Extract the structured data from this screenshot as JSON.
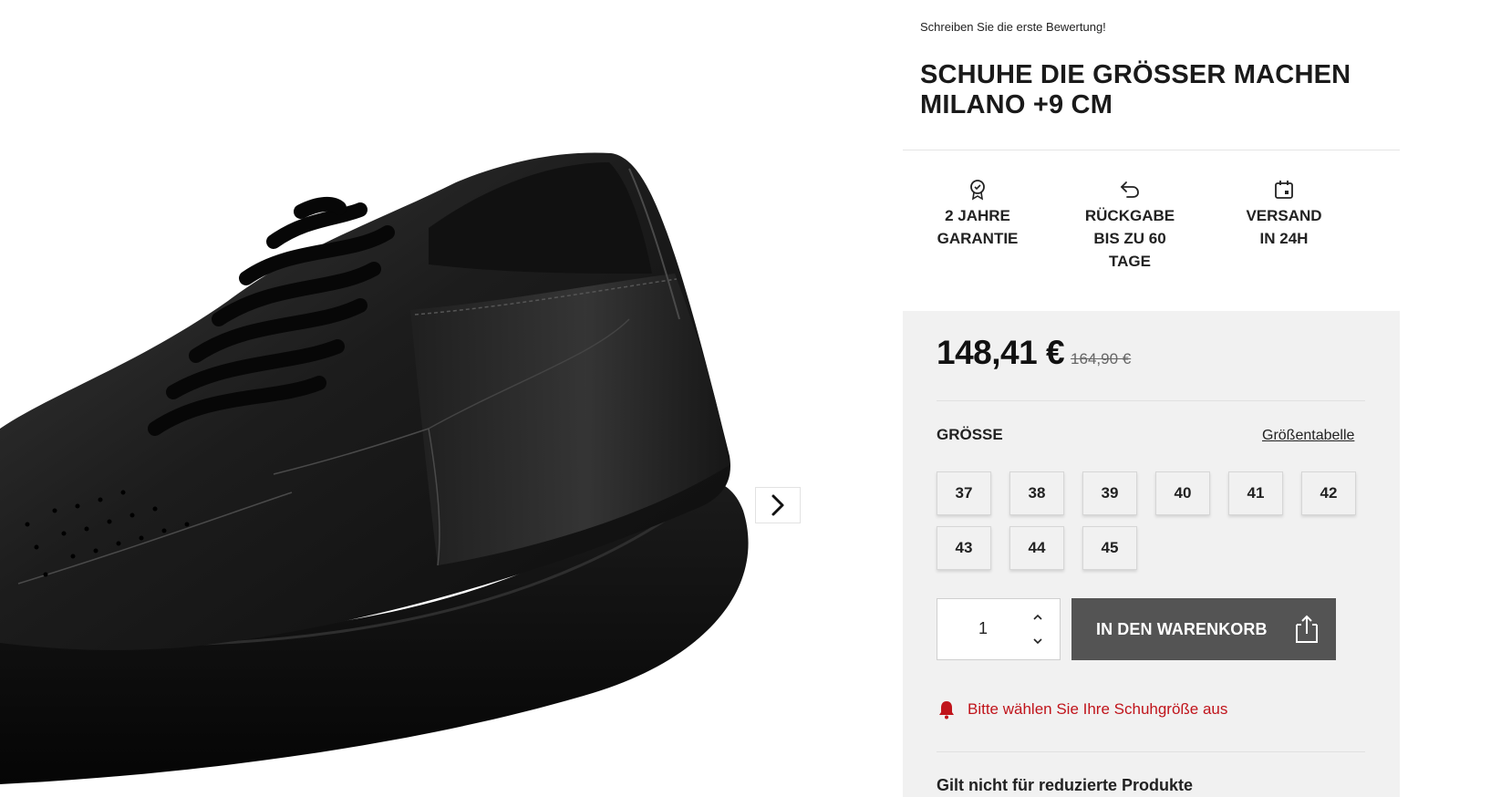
{
  "gallery": {
    "image_alt": "black leather sneaker",
    "next_icon": "chevron-right-icon"
  },
  "product": {
    "review_link": "Schreiben Sie die erste Bewertung!",
    "title": "SCHUHE DIE GRÖSSER MACHEN MILANO +9 CM"
  },
  "benefits": [
    {
      "icon": "warranty-badge-icon",
      "label_line1": "2 JAHRE",
      "label_line2": "GARANTIE",
      "label_line3": ""
    },
    {
      "icon": "return-arrow-icon",
      "label_line1": "RÜCKGABE",
      "label_line2": "BIS ZU 60",
      "label_line3": "TAGE"
    },
    {
      "icon": "calendar-icon",
      "label_line1": "VERSAND",
      "label_line2": "IN 24H",
      "label_line3": ""
    }
  ],
  "price": {
    "current": "148,41 €",
    "old": "164,90 €"
  },
  "size": {
    "label": "GRÖSSE",
    "chart_link": "Größentabelle",
    "options": [
      "37",
      "38",
      "39",
      "40",
      "41",
      "42",
      "43",
      "44",
      "45"
    ]
  },
  "quantity": {
    "value": "1"
  },
  "cart": {
    "button_label": "IN DEN WARENKORB",
    "icon": "shopping-bag-icon"
  },
  "warning": {
    "icon": "bell-icon",
    "text": "Bitte wählen Sie Ihre Schuhgröße aus",
    "color": "#c0141b"
  },
  "note": {
    "title": "Gilt nicht für reduzierte Produkte"
  },
  "colors": {
    "cart_button": "#545454",
    "buy_box_bg": "#f1f1f1",
    "warning": "#c0141b"
  }
}
